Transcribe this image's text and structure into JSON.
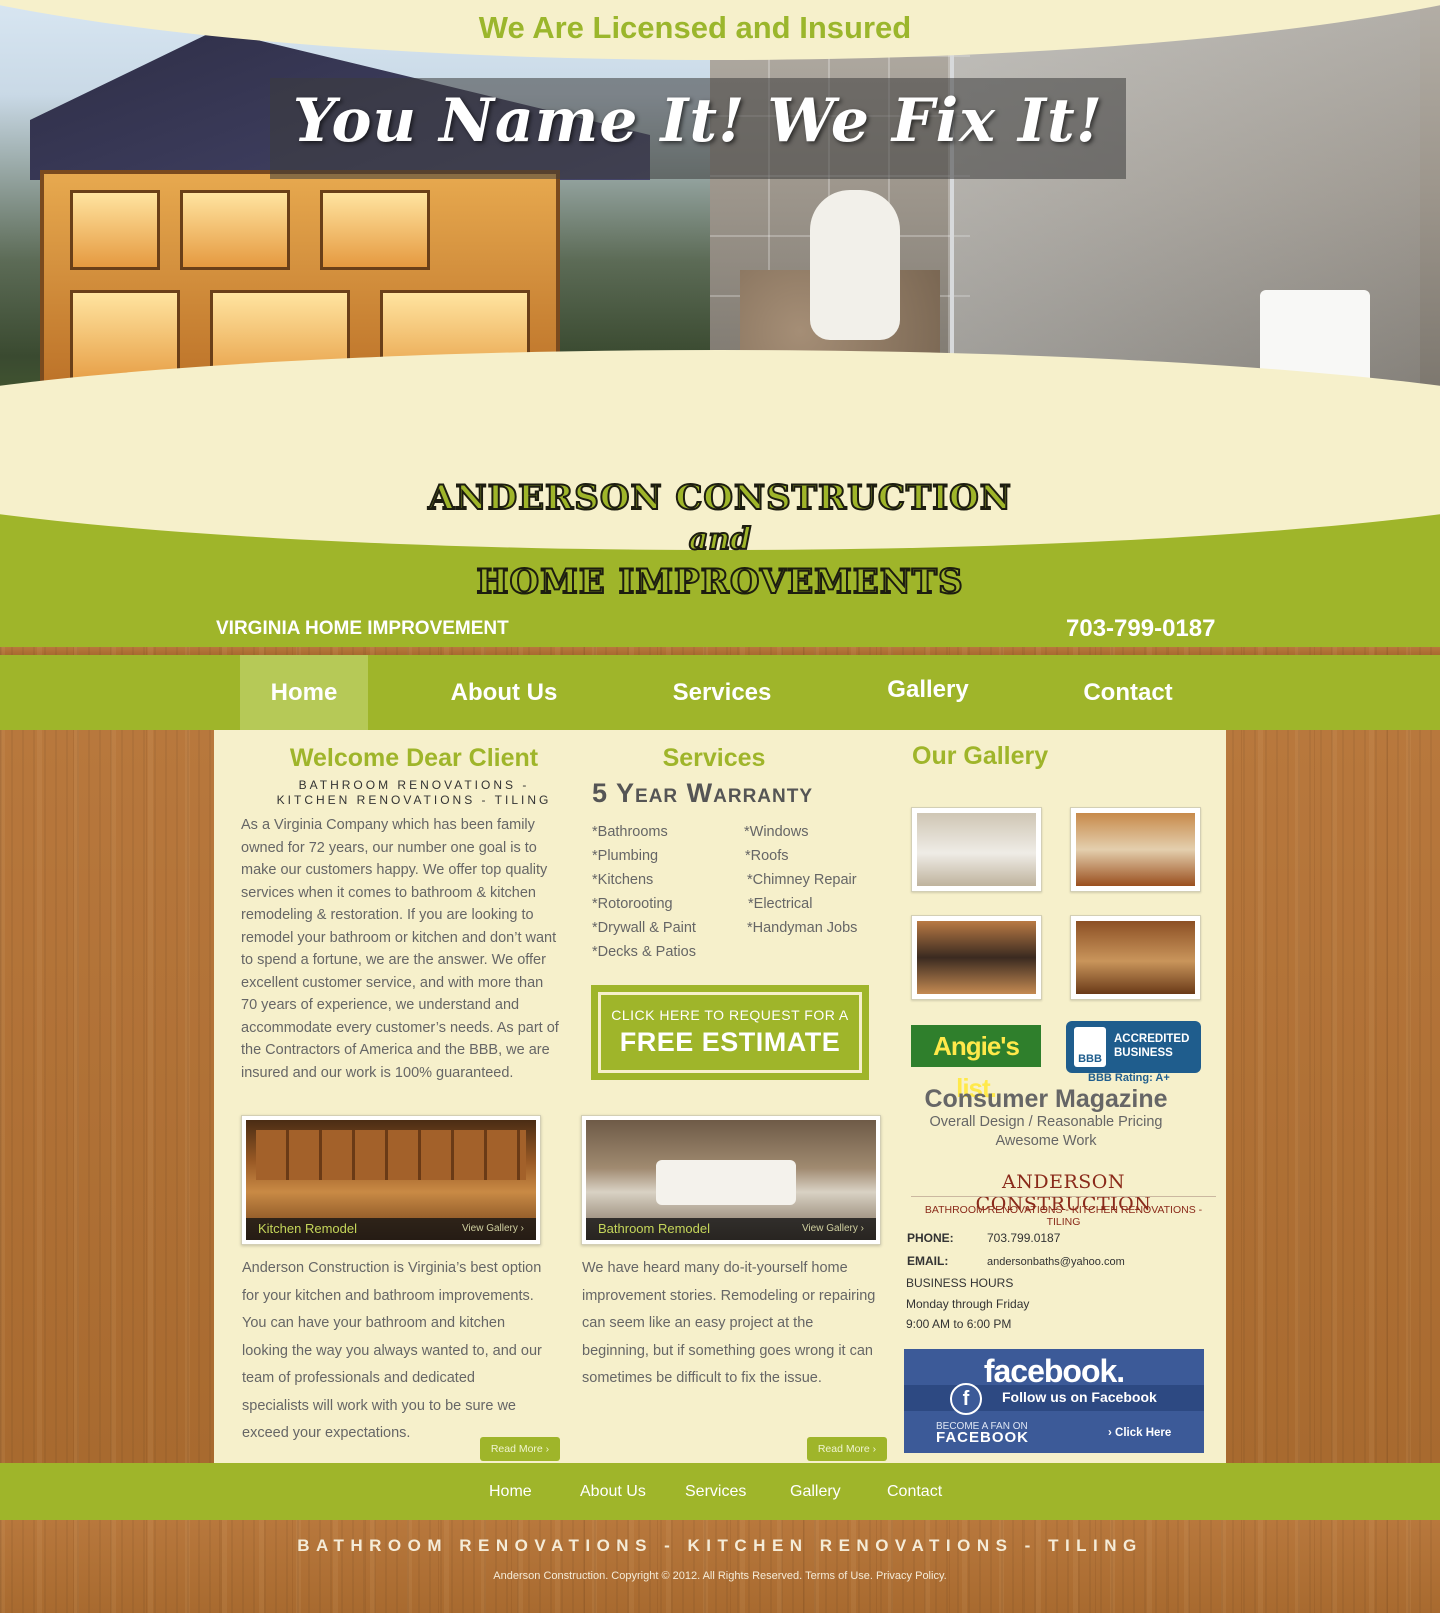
{
  "header": {
    "license_text": "We Are Licensed and Insured",
    "tagline": "You Name It! We Fix It!",
    "brand_line1": "ANDERSON CONSTRUCTION",
    "brand_line2": "and",
    "brand_line3": "HOME IMPROVEMENTS",
    "region": "VIRGINIA HOME IMPROVEMENT",
    "phone": "703-799-0187"
  },
  "nav": {
    "items": [
      {
        "label": "Home",
        "active": true
      },
      {
        "label": "About Us"
      },
      {
        "label": "Services"
      },
      {
        "label": "Gallery"
      },
      {
        "label": "Contact"
      }
    ]
  },
  "welcome": {
    "title": "Welcome Dear Client",
    "subtitle_line1": "BATHROOM RENOVATIONS -",
    "subtitle_line2": "KITCHEN RENOVATIONS - TILING",
    "body": "As a Virginia Company which has been family owned for 72 years, our number one goal is to make our customers happy. We offer top quality services when it comes to bathroom & kitchen remodeling & restoration. If you are looking to remodel your bathroom or kitchen and don’t want to spend a fortune, we are the answer. We offer excellent customer service, and with more than 70 years of experience, we understand and accommodate every customer’s needs. As part of the Contractors of America and the BBB, we are insured and our work is 100% guaranteed."
  },
  "services": {
    "title": "Services",
    "warranty": "5 Year Warranty",
    "left": [
      "*Bathrooms",
      "*Plumbing",
      "*Kitchens",
      "*Rotorooting",
      "*Drywall & Paint",
      "*Decks & Patios"
    ],
    "right": [
      "*Windows",
      "*Roofs",
      "*Chimney Repair",
      "*Electrical",
      "*Handyman Jobs"
    ],
    "estimate_line1": "CLICK HERE TO REQUEST FOR A",
    "estimate_line2": "FREE ESTIMATE"
  },
  "remodels": [
    {
      "caption": "Kitchen Remodel",
      "view": "View Gallery ›",
      "text": "Anderson Construction is Virginia’s best option for your kitchen and bathroom improvements. You can have your bathroom and kitchen looking the way you always wanted to, and our team of professionals and dedicated specialists will work with you to be sure we exceed your expectations.",
      "read_more": "Read More ›"
    },
    {
      "caption": "Bathroom Remodel",
      "view": "View Gallery ›",
      "text": "We have heard many do-it-yourself home improvement stories. Remodeling or repairing can seem like an easy project at the beginning, but if something goes wrong it can sometimes be difficult to fix the issue.",
      "read_more": "Read More ›"
    }
  ],
  "gallery": {
    "title": "Our Gallery",
    "thumbs": [
      "bathroom-tub-photo",
      "kitchen-island-photo",
      "kitchen-dining-photo",
      "kitchen-cabinets-photo"
    ]
  },
  "badges": {
    "angies": "Angie's list.",
    "bbb_logo": "BBB",
    "bbb_line1": "ACCREDITED",
    "bbb_line2": "BUSINESS",
    "bbb_rating": "BBB Rating: A+"
  },
  "consumer": {
    "title": "Consumer Magazine",
    "line1": "Overall Design  / Reasonable Pricing",
    "line2": "Awesome Work"
  },
  "contact_card": {
    "title": "ANDERSON CONSTRUCTION",
    "subtitle": "BATHROOM RENOVATIONS - KITCHEN RENOVATIONS - TILING",
    "phone_label": "PHONE:",
    "phone": "703.799.0187",
    "email_label": "EMAIL:",
    "email": "andersonbaths@yahoo.com",
    "hours_label": "BUSINESS HOURS",
    "hours_days": "Monday through Friday",
    "hours_time": "9:00 AM to 6:00 PM"
  },
  "facebook": {
    "wordmark": "facebook.",
    "f": "f",
    "follow": "Follow us on Facebook",
    "become": "BECOME A FAN ON",
    "become_brand": "FACEBOOK",
    "click": "› Click Here"
  },
  "footer": {
    "nav": [
      "Home",
      "About Us",
      "Services",
      "Gallery",
      "Contact"
    ],
    "tagline": "BATHROOM RENOVATIONS - KITCHEN RENOVATIONS - TILING",
    "copyright": "Anderson Construction. Copyright © 2012. All Rights Reserved. Terms of Use. Privacy Policy."
  },
  "colors": {
    "accent_green": "#9fb52a",
    "cream": "#f6f0cb",
    "wood": "#b0723a",
    "brand_red": "#8a2a1a",
    "facebook_blue": "#3c5a98"
  }
}
